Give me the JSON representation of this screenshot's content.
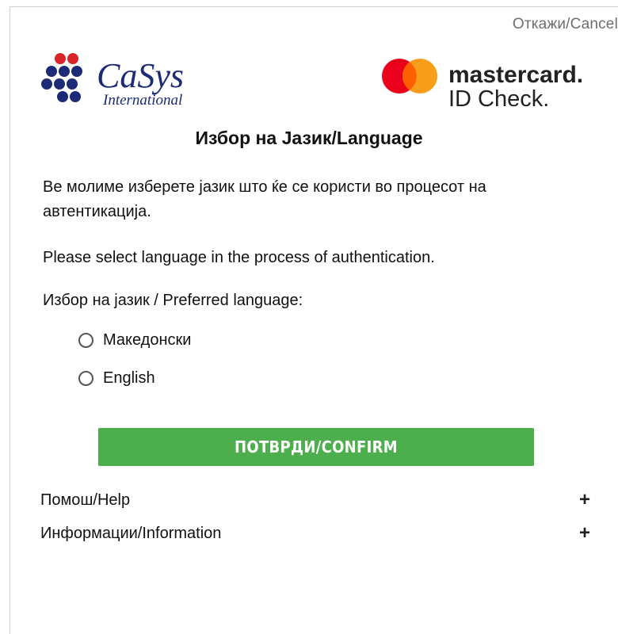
{
  "header": {
    "cancel_label": "Откажи/Cancel"
  },
  "logos": {
    "casys": {
      "name": "CaSys",
      "tagline": "International",
      "color": "#1c2a78",
      "dot_red": "#d9252a",
      "dot_blue": "#1c2a78"
    },
    "mastercard": {
      "brand": "mastercard.",
      "product": "ID Check.",
      "red": "#eb001b",
      "orange": "#f79e1b",
      "overlap": "#ff5f00"
    }
  },
  "main": {
    "title": "Избор на Јазик/Language",
    "instructions_mk": "Ве молиме изберете јазик што ќе се користи во процесот на автентикација.",
    "instructions_en": "Please select language in the process of authentication.",
    "preferred_label": "Избор на јазик / Preferred language:",
    "language_options": [
      {
        "label": "Македонски",
        "selected": false
      },
      {
        "label": "English",
        "selected": false
      }
    ],
    "confirm_label": "ПОТВРДИ/CONFIRM"
  },
  "accordion": [
    {
      "label": "Помош/Help",
      "toggle": "+"
    },
    {
      "label": "Информации/Information",
      "toggle": "+"
    }
  ],
  "colors": {
    "confirm_button": "#4cae4c",
    "cancel_text": "#6e6e6e"
  }
}
